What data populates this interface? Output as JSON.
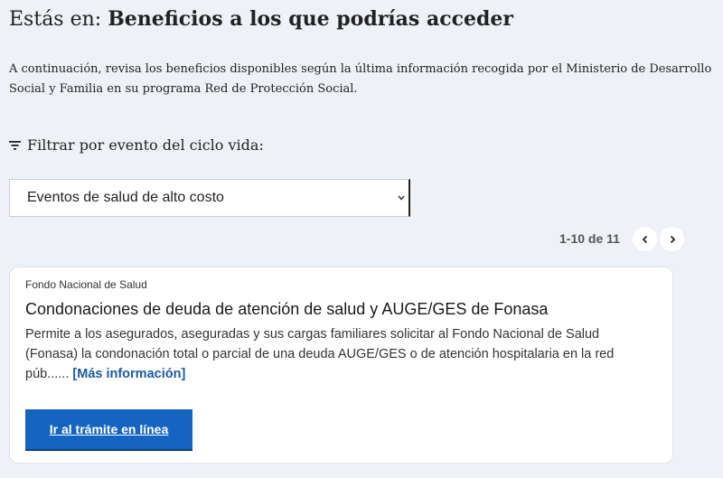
{
  "header": {
    "prefix": "Estás en: ",
    "title": "Beneficios a los que podrías acceder"
  },
  "intro": {
    "text": "A continuación, revisa los beneficios disponibles según la última información recogida por el Ministerio de Desarrollo Social y Familia en su programa Red de Protección Social."
  },
  "filter": {
    "label": "Filtrar por evento del ciclo vida:",
    "icon": "filter-icon",
    "selected": "Eventos de salud de alto costo"
  },
  "pagination": {
    "range": "1-10 de 11",
    "prev_icon": "chevron-left-icon",
    "next_icon": "chevron-right-icon"
  },
  "benefit_card": {
    "agency": "Fondo Nacional de Salud",
    "title": "Condonaciones de deuda de atención de salud y AUGE/GES de Fonasa",
    "description": "Permite a los asegurados, aseguradas y sus cargas familiares solicitar al Fondo Nacional de Salud (Fonasa) la condonación total o parcial de una deuda AUGE/GES o de atención hospitalaria en la red púb......",
    "more_open": " [",
    "more_label": "Más información",
    "more_close": "]",
    "cta_label": "Ir al trámite en línea"
  },
  "colors": {
    "background": "#eef2f7",
    "primary": "#1565c0",
    "link": "#1b5a9e"
  }
}
